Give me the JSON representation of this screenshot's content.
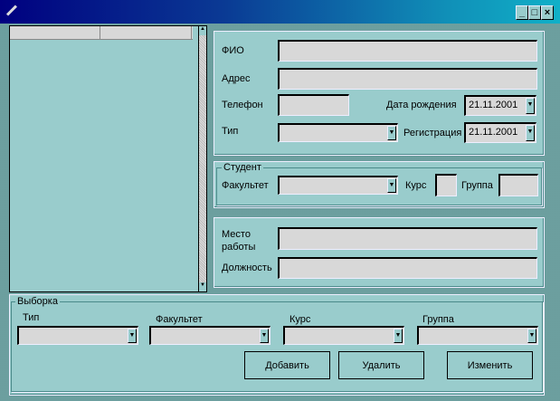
{
  "window": {
    "title": "",
    "buttons": {
      "minimize": "_",
      "maximize": "□",
      "close": "×"
    }
  },
  "list": {
    "columns": [
      "",
      ""
    ]
  },
  "person": {
    "fio_label": "ФИО",
    "fio_value": "",
    "address_label": "Адрес",
    "address_value": "",
    "phone_label": "Телефон",
    "phone_value": "",
    "birth_label": "Дата рождения",
    "birth_value": "21.11.2001",
    "type_label": "Тип",
    "type_value": "",
    "reg_label": "Регистрация",
    "reg_value": "21.11.2001"
  },
  "student": {
    "legend": "Студент",
    "faculty_label": "Факультет",
    "faculty_value": "",
    "course_label": "Курс",
    "course_value": "",
    "group_label": "Группа",
    "group_value": ""
  },
  "work": {
    "place_label": "Место работы",
    "place_value": "",
    "position_label": "Должность",
    "position_value": ""
  },
  "filter": {
    "legend": "Выборка",
    "type_label": "Тип",
    "faculty_label": "Факультет",
    "course_label": "Курс",
    "group_label": "Группа"
  },
  "actions": {
    "add": "Добавить",
    "delete": "Удалить",
    "edit": "Изменить"
  }
}
